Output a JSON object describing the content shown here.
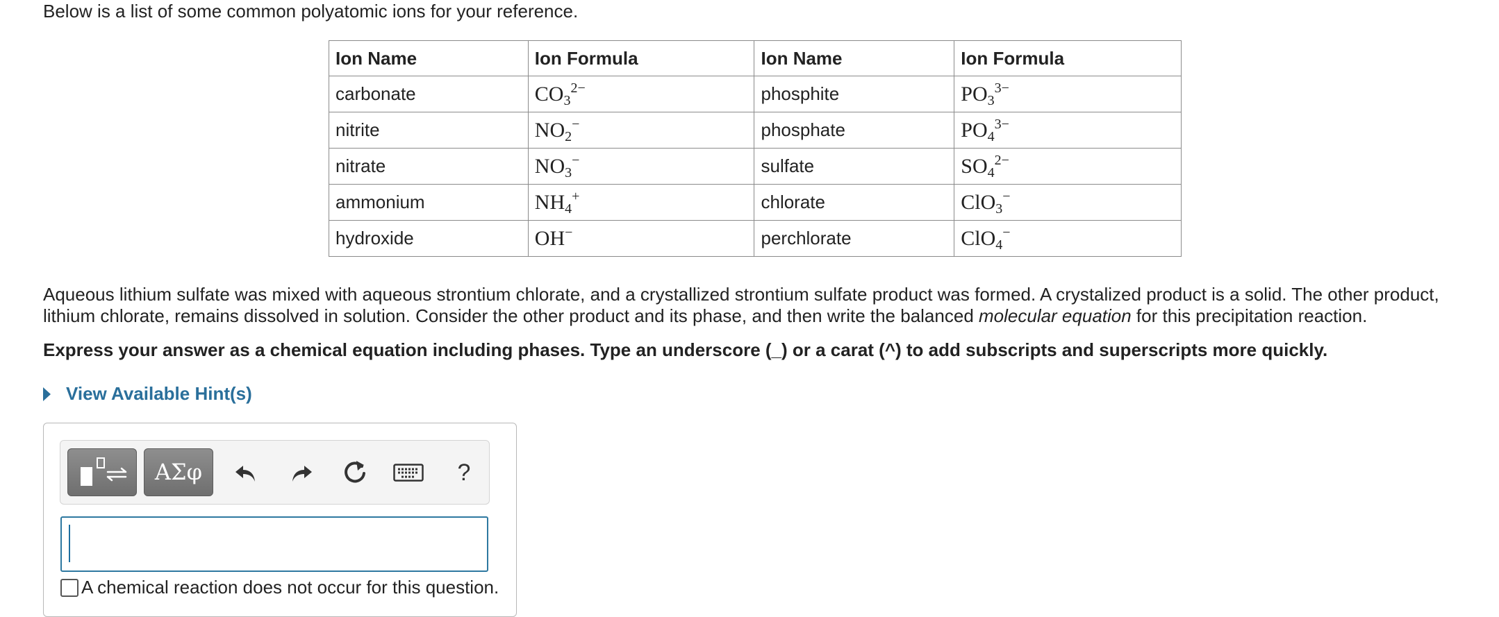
{
  "intro": "Below is a list of some common polyatomic ions for your reference.",
  "ion_table": {
    "headers": [
      "Ion Name",
      "Ion Formula",
      "Ion Name",
      "Ion Formula"
    ],
    "rows": [
      {
        "name1": "carbonate",
        "f1_base": "CO",
        "f1_sub": "3",
        "f1_sup": "2−",
        "name2": "phosphite",
        "f2_base": "PO",
        "f2_sub": "3",
        "f2_sup": "3−"
      },
      {
        "name1": "nitrite",
        "f1_base": "NO",
        "f1_sub": "2",
        "f1_sup": "−",
        "name2": "phosphate",
        "f2_base": "PO",
        "f2_sub": "4",
        "f2_sup": "3−"
      },
      {
        "name1": "nitrate",
        "f1_base": "NO",
        "f1_sub": "3",
        "f1_sup": "−",
        "name2": "sulfate",
        "f2_base": "SO",
        "f2_sub": "4",
        "f2_sup": "2−"
      },
      {
        "name1": "ammonium",
        "f1_base": "NH",
        "f1_sub": "4",
        "f1_sup": "+",
        "name2": "chlorate",
        "f2_base": "ClO",
        "f2_sub": "3",
        "f2_sup": "−"
      },
      {
        "name1": "hydroxide",
        "f1_base": "OH",
        "f1_sub": "",
        "f1_sup": "−",
        "name2": "perchlorate",
        "f2_base": "ClO",
        "f2_sub": "4",
        "f2_sup": "−"
      }
    ]
  },
  "question": {
    "part1": "Aqueous lithium sulfate was mixed with aqueous strontium chlorate, and a crystallized strontium sulfate product was formed. A crystalized product is a solid. The other product, lithium chlorate, remains dissolved in solution. Consider the other product and its phase, and then write the balanced ",
    "emphasis": "molecular equation",
    "part2": " for this precipitation reaction."
  },
  "instruction": "Express your answer as a chemical equation including phases. Type an underscore (_) or a carat (^) to add subscripts and superscripts more quickly.",
  "hints_label": "View Available Hint(s)",
  "toolbar": {
    "greek_label": "ΑΣφ",
    "help_label": "?",
    "icons": [
      "templates-icon",
      "undo-icon",
      "redo-icon",
      "reset-icon",
      "keyboard-icon",
      "help-icon"
    ]
  },
  "answer": {
    "value": ""
  },
  "no_reaction_label": "A chemical reaction does not occur for this question.",
  "colors": {
    "link": "#2a6f9b",
    "input_border": "#2d78a0",
    "button": "#7d7d7d"
  }
}
